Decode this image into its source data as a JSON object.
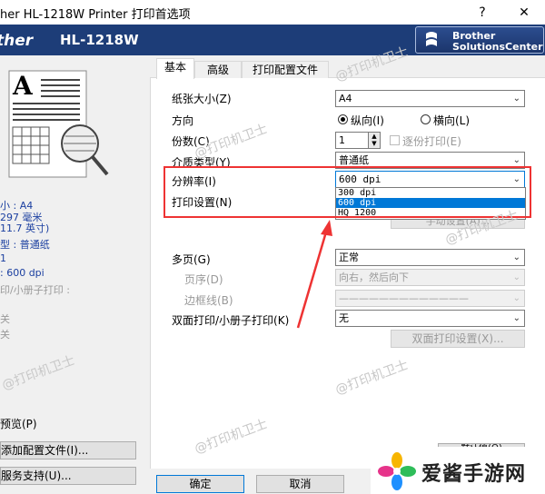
{
  "window": {
    "title": "her HL-1218W Printer 打印首选项",
    "help_label": "?",
    "close_label": "✕"
  },
  "brand": {
    "left_logo_text": "ther",
    "model": "HL-1218W",
    "solutions_line1": "Brother",
    "solutions_line2": "SolutionsCenter"
  },
  "summary": {
    "lines": [
      {
        "text": "小 : A4",
        "style": "blue"
      },
      {
        "text": "297 毫米",
        "style": "blue"
      },
      {
        "text": "11.7 英寸)",
        "style": "blue"
      },
      {
        "text": "型 : 普通纸",
        "style": "blue"
      },
      {
        "text": "1",
        "style": "blue"
      },
      {
        "text": ": 600 dpi",
        "style": "blue"
      },
      {
        "text": "印/小册子打印 :",
        "style": "gray"
      },
      {
        "text": "关",
        "style": "gray"
      },
      {
        "text": "关",
        "style": "gray"
      }
    ],
    "preview_check_label": "预览(P)",
    "add_profile_button": "添加配置文件(I)...",
    "support_button": "服务支持(U)..."
  },
  "tabs": [
    {
      "label": "基本",
      "active": true
    },
    {
      "label": "高级",
      "active": false
    },
    {
      "label": "打印配置文件",
      "active": false
    }
  ],
  "basic": {
    "paper_size": {
      "label": "纸张大小(Z)",
      "value": "A4"
    },
    "orientation": {
      "label": "方向",
      "portrait": "纵向(I)",
      "landscape": "横向(L)",
      "selected": "portrait"
    },
    "copies": {
      "label": "份数(C)",
      "value": "1",
      "collate_label": "逐份打印(E)"
    },
    "media_type": {
      "label": "介质类型(Y)",
      "value": "普通纸"
    },
    "resolution": {
      "label": "分辨率(I)",
      "value": "600 dpi",
      "options": [
        "300 dpi",
        "600 dpi",
        "HQ 1200"
      ],
      "highlighted": "600 dpi"
    },
    "print_settings": {
      "label": "打印设置(N)"
    },
    "manual_settings_button": "手动设置(A)...",
    "multiple_page": {
      "label": "多页(G)",
      "value": "正常"
    },
    "page_order": {
      "label": "页序(D)",
      "value": "向右，然后向下"
    },
    "border_line": {
      "label": "边框线(B)",
      "value": "—————————————"
    },
    "duplex": {
      "label": "双面打印/小册子打印(K)",
      "value": "无"
    },
    "duplex_settings_button": "双面打印设置(X)...",
    "default_button": "默认值(Q)"
  },
  "footer": {
    "ok": "确定",
    "cancel": "取消"
  },
  "watermark": {
    "text": "@打印机卫士",
    "site_name": "爱酱手游网"
  },
  "colors": {
    "brand_blue": "#1d3d78",
    "selection_blue": "#0078d7",
    "annotation_red": "#e33333"
  }
}
